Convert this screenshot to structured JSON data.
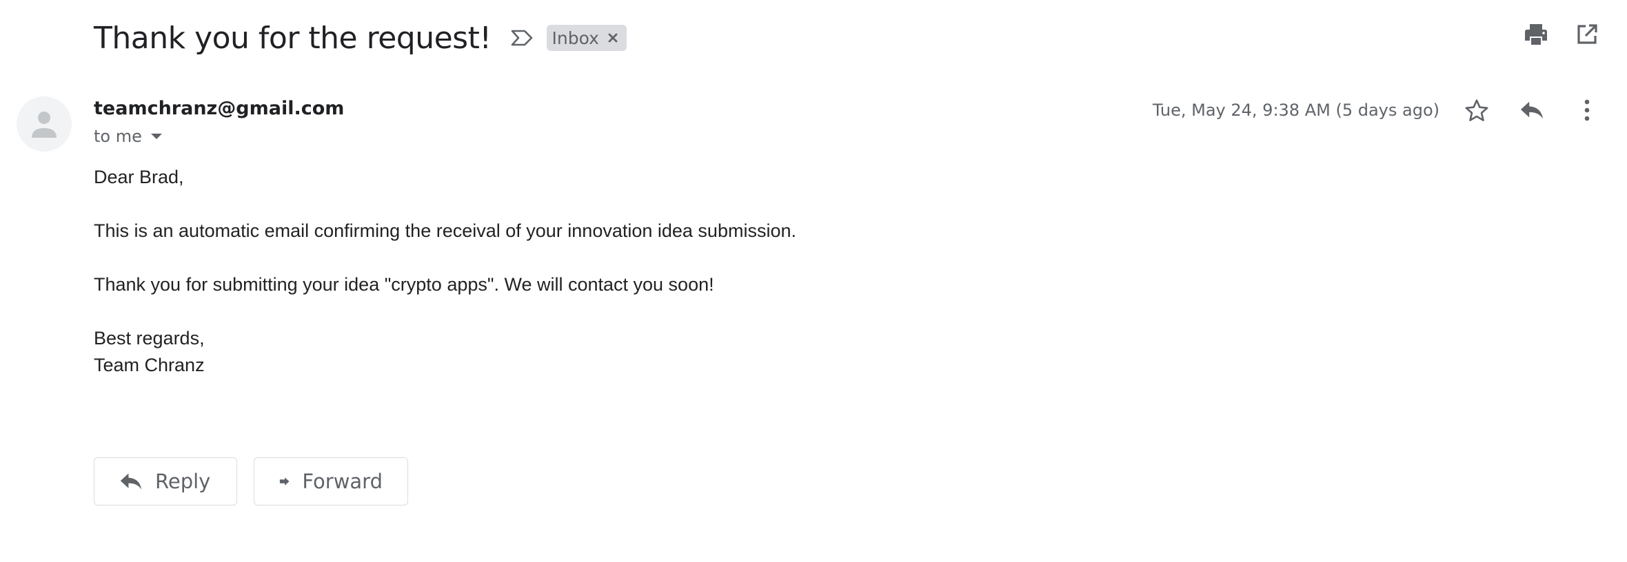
{
  "subject": "Thank you for the request!",
  "label_chip": {
    "text": "Inbox",
    "remove_glyph": "×"
  },
  "icons": {
    "importance": "label-importance-icon",
    "print": "print-icon",
    "open_new_window": "open-in-new-window-icon",
    "star": "star-icon",
    "reply": "reply-icon",
    "more": "more-vert-icon",
    "avatar": "person-icon",
    "recipient_dropdown": "caret-down-icon",
    "forward": "forward-icon"
  },
  "sender": {
    "email": "teamchranz@gmail.com",
    "recipient_text": "to me"
  },
  "date": "Tue, May 24, 9:38 AM (5 days ago)",
  "body": {
    "greeting": "Dear Brad,",
    "line1": "This is an automatic email confirming the receival of your innovation idea submission.",
    "line2": "Thank you for submitting your idea \"crypto apps\". We will contact you soon!",
    "closing": "Best regards,",
    "signature": "Team Chranz"
  },
  "actions": {
    "reply_label": "Reply",
    "forward_label": "Forward"
  },
  "colors": {
    "icon_gray": "#5f6368",
    "chip_bg": "#dadce0",
    "avatar_bg": "#f1f3f4",
    "avatar_fg": "#c4c7c9"
  }
}
